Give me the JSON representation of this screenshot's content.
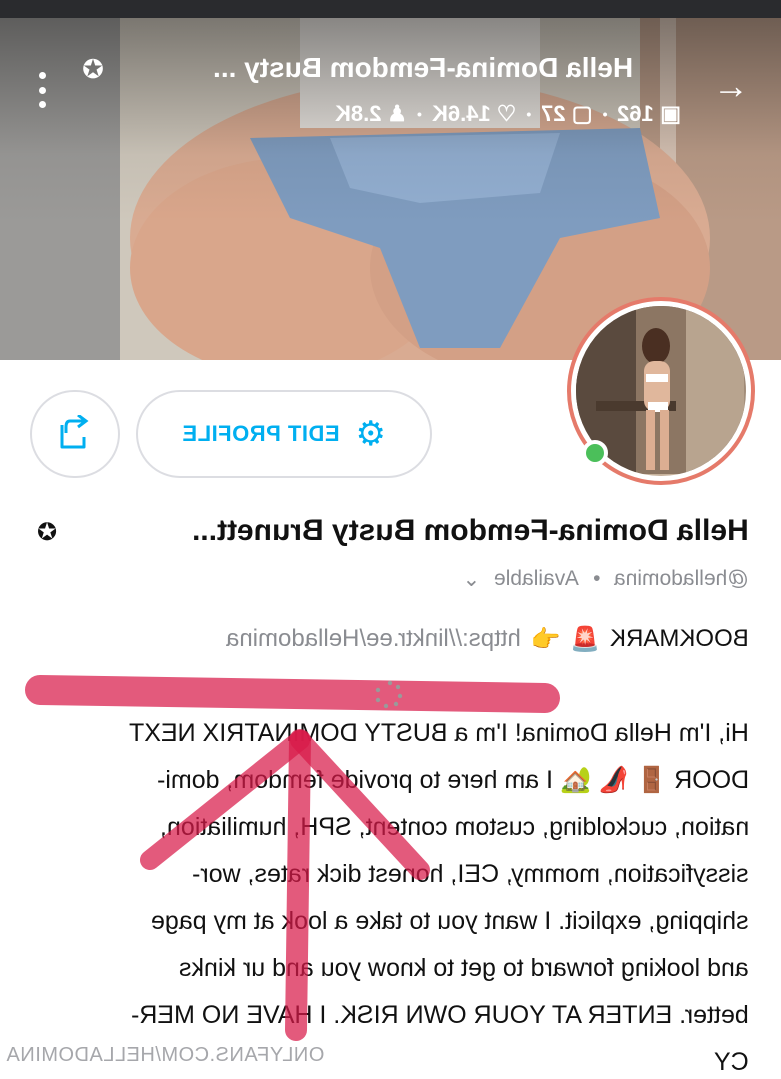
{
  "header": {
    "title": "Hella Domina-Femdom Busty ...",
    "stats": [
      {
        "icon": "image-icon",
        "value": "162"
      },
      {
        "icon": "video-icon",
        "value": "27"
      },
      {
        "icon": "heart-icon",
        "value": "14.6K"
      },
      {
        "icon": "fans-icon",
        "value": "2.8K"
      }
    ]
  },
  "profile": {
    "edit_label": "EDIT PROFILE",
    "name": "Hella Domina-Femdom Busty Brunett...",
    "handle": "@helladomina",
    "availability": "Available",
    "bookmark_label": "BOOKMARK",
    "bookmark_link": "https://linktr.ee/Helladomina"
  },
  "bio": {
    "lines": [
      "Hi, I'm Hella Domina! I'm a BUSTY DOMINATRIX NEXT",
      "DOOR 🚪 👠 🏡 I am here to provide femdom, domi-",
      "nation, cuckolding, custom content, SPH, humiliation,",
      "sissyfication, mommy, CEI, honest dick rates, wor-",
      "shipping, explicit. I want you to take a look at my page",
      "and looking forward to get to know you and ur kinks",
      "better. ENTER AT YOUR OWN RISK. I HAVE NO MER-",
      "CY"
    ]
  },
  "watermark": "ONLYFANS.COM/HELLADOMINA",
  "colors": {
    "accent": "#00aff0",
    "online": "#4bbf5a",
    "avatar_ring": "#e57a6a",
    "annotation": "#d81b4a"
  }
}
